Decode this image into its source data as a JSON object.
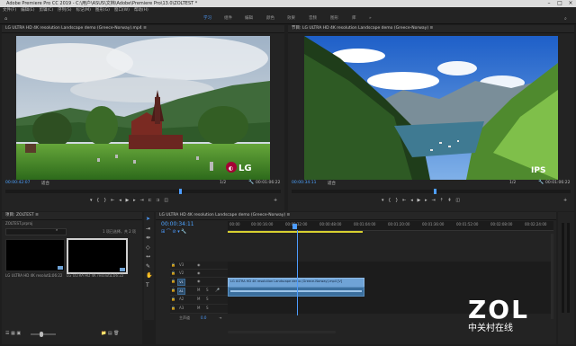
{
  "window": {
    "title": "Adobe Premiere Pro CC 2019 - C:\\用户\\ASUS\\文档\\Adobe\\Premiere Pro\\13.0\\ZOLTEST *"
  },
  "menu": [
    "文件(F)",
    "编辑(E)",
    "剪辑(C)",
    "序列(S)",
    "标记(M)",
    "图形(G)",
    "窗口(W)",
    "帮助(H)"
  ],
  "workspaces": [
    "学习",
    "组件",
    "编辑",
    "颜色",
    "效果",
    "音频",
    "图形",
    "库"
  ],
  "source_monitor": {
    "title": "LG ULTRA HD 4K resolution Landscape demo (Greece-Norway).mp4 ≡",
    "timecode": "00:00:42:07",
    "fit": "适合",
    "fraction": "1/2",
    "duration": "00:01:06:22",
    "logo_text": "LG"
  },
  "program_monitor": {
    "title": "节目: LG ULTRA HD 4K resolution Landscape demo (Greece-Norway) ≡",
    "timecode": "00:00:34:11",
    "fit": "适合",
    "fraction": "1/2",
    "duration": "00:01:06:22",
    "logo_text": "IPS"
  },
  "project": {
    "title": "项目: ZOLTEST ≡",
    "file": "ZOLTEST.prproj",
    "selection": "1 项已选择，共 2 项",
    "items": [
      {
        "name": "LG ULTRA HD 4K resoluti...",
        "duration": "1:06:22"
      },
      {
        "name": "LG ULTRA HD 4K resoluti...",
        "duration": "1:06:22"
      }
    ]
  },
  "timeline": {
    "title": "LG ULTRA HD 4K resolution Landscape demo (Greece-Norway) ≡",
    "timecode": "00:00:34:11",
    "ruler": [
      "00:00",
      "00:00:16:00",
      "00:00:32:00",
      "00:00:48:00",
      "00:01:04:00",
      "00:01:20:00",
      "00:01:36:00",
      "00:01:52:00",
      "00:02:08:00",
      "00:02:24:00"
    ],
    "video_tracks": [
      "V3",
      "V2",
      "V1"
    ],
    "audio_tracks": [
      "A1",
      "A2",
      "A3"
    ],
    "master": "主声道",
    "master_value": "0.0",
    "clip_label": "LG ULTRA HD 4K resolution Landscape demo (Greece-Norway).mp4 [V]"
  },
  "watermark": {
    "brand": "ZOL",
    "sub": "中关村在线"
  },
  "colors": {
    "accent": "#4d9cff",
    "clip_video": "#6fa3d6",
    "clip_audio": "#3b6f9e",
    "playhead": "#4d9cff"
  }
}
